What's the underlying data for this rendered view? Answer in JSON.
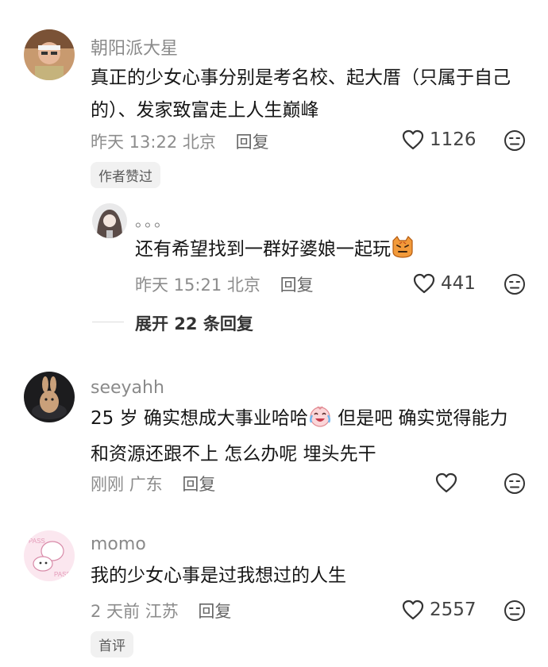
{
  "comments": [
    {
      "username": "朝阳派大星",
      "text": "真正的少女心事分别是考名校、起大厝（只属于自己的）、发家致富走上人生巅峰",
      "time": "昨天 13:22",
      "location": "北京",
      "reply_label": "回复",
      "likes": "1126",
      "badge": "作者赞过",
      "replies": [
        {
          "username": "。。。",
          "text": "还有希望找到一群好婆娘一起玩",
          "emoji": "cat-face-emoji",
          "time": "昨天 15:21",
          "location": "北京",
          "reply_label": "回复",
          "likes": "441"
        }
      ],
      "expand_label": "展开 22 条回复"
    },
    {
      "username": "seeyahh",
      "text_part1": "25 岁  确实想成大事业哈哈",
      "emoji": "crying-laughing-emoji",
      "text_part2": " 但是吧  确实觉得能力和资源还跟不上  怎么办呢  埋头先干",
      "time": "刚刚",
      "location": "广东",
      "reply_label": "回复",
      "likes": ""
    },
    {
      "username": "momo",
      "text": "我的少女心事是过我想过的人生",
      "time": "2 天前",
      "location": "江苏",
      "reply_label": "回复",
      "likes": "2557",
      "badge": "首评"
    }
  ],
  "icons": {
    "like": "heart-outline-icon",
    "dislike": "meh-face-icon"
  },
  "colors": {
    "muted": "#8c8c8c",
    "text": "#161616",
    "tag_bg": "#f1f1f1"
  }
}
